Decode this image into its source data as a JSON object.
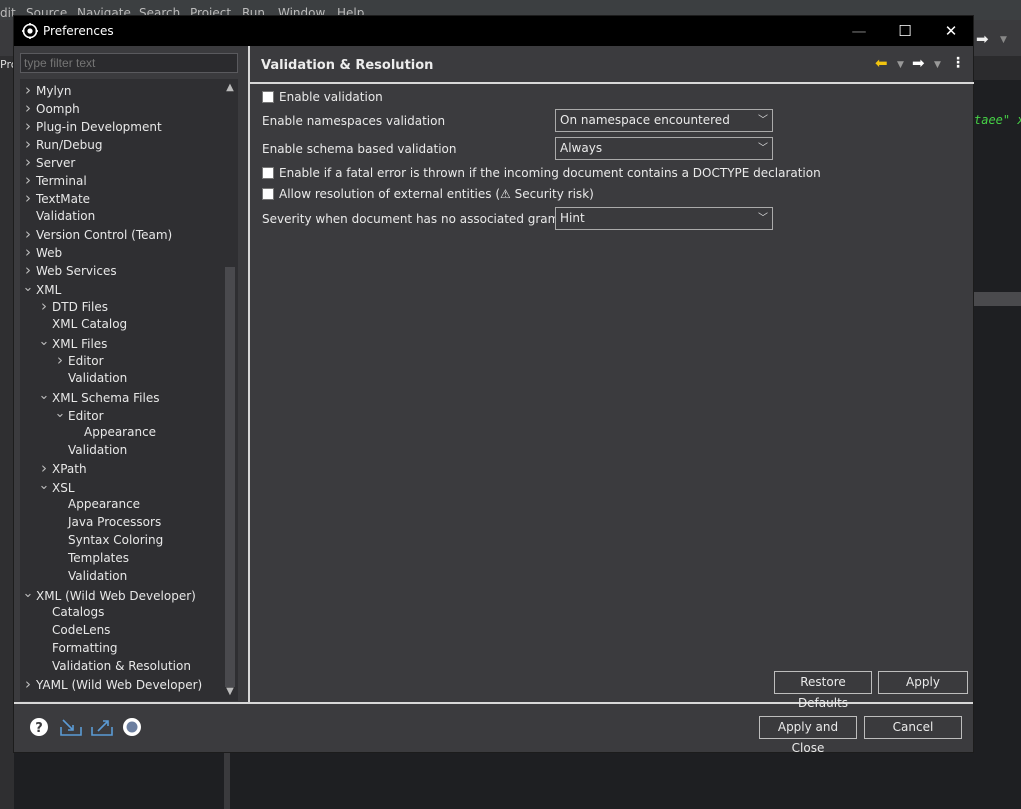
{
  "ide": {
    "menu": [
      "dit",
      "Source",
      "Navigate",
      "Search",
      "Project",
      "Run",
      "Window",
      "Help"
    ],
    "side_label": "Pro",
    "editor_text": "taee\" x"
  },
  "dialog": {
    "title": "Preferences",
    "filter_placeholder": "type filter text",
    "page_title": "Validation & Resolution",
    "window_controls": {
      "minimize": "—",
      "maximize": "☐",
      "close": "✕"
    }
  },
  "tree": [
    {
      "label": "Mylyn",
      "level": 0,
      "arrow": "collapsed"
    },
    {
      "label": "Oomph",
      "level": 0,
      "arrow": "collapsed"
    },
    {
      "label": "Plug-in Development",
      "level": 0,
      "arrow": "collapsed"
    },
    {
      "label": "Run/Debug",
      "level": 0,
      "arrow": "collapsed"
    },
    {
      "label": "Server",
      "level": 0,
      "arrow": "collapsed"
    },
    {
      "label": "Terminal",
      "level": 0,
      "arrow": "collapsed"
    },
    {
      "label": "TextMate",
      "level": 0,
      "arrow": "collapsed"
    },
    {
      "label": "Validation",
      "level": 0,
      "arrow": "none"
    },
    {
      "label": "Version Control (Team)",
      "level": 0,
      "arrow": "collapsed"
    },
    {
      "label": "Web",
      "level": 0,
      "arrow": "collapsed"
    },
    {
      "label": "Web Services",
      "level": 0,
      "arrow": "collapsed"
    },
    {
      "label": "XML",
      "level": 0,
      "arrow": "expanded"
    },
    {
      "label": "DTD Files",
      "level": 1,
      "arrow": "collapsed"
    },
    {
      "label": "XML Catalog",
      "level": 1,
      "arrow": "none"
    },
    {
      "label": "XML Files",
      "level": 1,
      "arrow": "expanded"
    },
    {
      "label": "Editor",
      "level": 2,
      "arrow": "collapsed"
    },
    {
      "label": "Validation",
      "level": 2,
      "arrow": "none"
    },
    {
      "label": "XML Schema Files",
      "level": 1,
      "arrow": "expanded"
    },
    {
      "label": "Editor",
      "level": 2,
      "arrow": "expanded"
    },
    {
      "label": "Appearance",
      "level": 3,
      "arrow": "none"
    },
    {
      "label": "Validation",
      "level": 2,
      "arrow": "none"
    },
    {
      "label": "XPath",
      "level": 1,
      "arrow": "collapsed"
    },
    {
      "label": "XSL",
      "level": 1,
      "arrow": "expanded"
    },
    {
      "label": "Appearance",
      "level": 2,
      "arrow": "none"
    },
    {
      "label": "Java Processors",
      "level": 2,
      "arrow": "none"
    },
    {
      "label": "Syntax Coloring",
      "level": 2,
      "arrow": "none"
    },
    {
      "label": "Templates",
      "level": 2,
      "arrow": "none"
    },
    {
      "label": "Validation",
      "level": 2,
      "arrow": "none"
    },
    {
      "label": "XML (Wild Web Developer)",
      "level": 0,
      "arrow": "expanded"
    },
    {
      "label": "Catalogs",
      "level": 1,
      "arrow": "none"
    },
    {
      "label": "CodeLens",
      "level": 1,
      "arrow": "none"
    },
    {
      "label": "Formatting",
      "level": 1,
      "arrow": "none"
    },
    {
      "label": "Validation & Resolution",
      "level": 1,
      "arrow": "none"
    },
    {
      "label": "YAML (Wild Web Developer)",
      "level": 0,
      "arrow": "collapsed"
    }
  ],
  "settings": {
    "enable_validation": {
      "label": "Enable validation",
      "checked": false
    },
    "namespaces": {
      "label": "Enable namespaces validation",
      "value": "On namespace encountered"
    },
    "schema": {
      "label": "Enable schema based validation",
      "value": "Always"
    },
    "fatal_error": {
      "label": "Enable if a fatal error is thrown if the incoming document contains a DOCTYPE declaration",
      "checked": false
    },
    "external_entities": {
      "label": "Allow resolution of external entities (⚠ Security risk)",
      "checked": false
    },
    "grammar": {
      "label": "Severity when document has no associated grammar",
      "value": "Hint"
    }
  },
  "buttons": {
    "restore_defaults": "Restore Defaults",
    "apply": "Apply",
    "apply_close": "Apply and Close",
    "cancel": "Cancel"
  },
  "icons": {
    "help": "help-icon",
    "import": "import-icon",
    "export": "export-icon",
    "record": "oomph-record-icon"
  }
}
